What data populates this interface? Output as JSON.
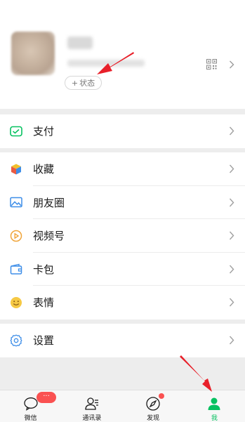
{
  "profile": {
    "status_label": "状态",
    "status_plus": "+"
  },
  "menu": {
    "pay": "支付",
    "favorites": "收藏",
    "moments": "朋友圈",
    "channels": "视频号",
    "card_package": "卡包",
    "stickers": "表情",
    "settings": "设置"
  },
  "tabbar": {
    "chats": "微信",
    "chats_badge": "···",
    "contacts": "通讯录",
    "discover": "发现",
    "me": "我"
  },
  "colors": {
    "accent": "#07c160",
    "badge": "#fa5151",
    "annotation_arrow": "#e8202a"
  }
}
